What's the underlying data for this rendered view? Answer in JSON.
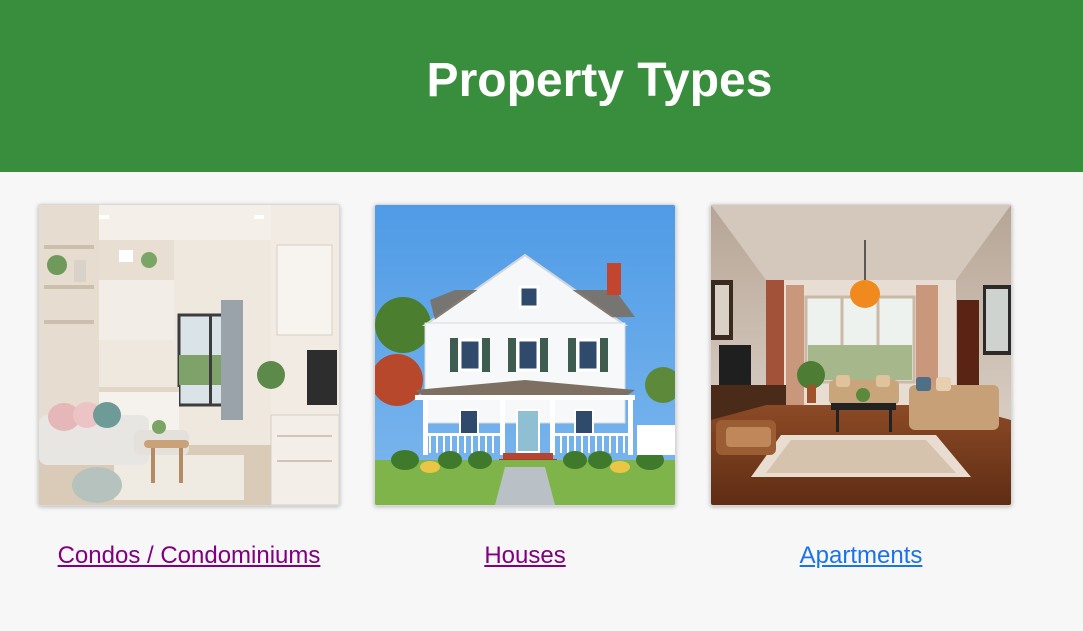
{
  "header": {
    "title": "Property Types"
  },
  "cards": [
    {
      "label": "Condos / Condominiums",
      "link_state": "visited",
      "link_color": "#800080"
    },
    {
      "label": "Houses",
      "link_state": "visited",
      "link_color": "#800080"
    },
    {
      "label": "Apartments",
      "link_state": "unvisited",
      "link_color": "#1a73e8"
    }
  ],
  "colors": {
    "header_bg": "#388e3c",
    "page_bg": "#f7f7f7"
  }
}
